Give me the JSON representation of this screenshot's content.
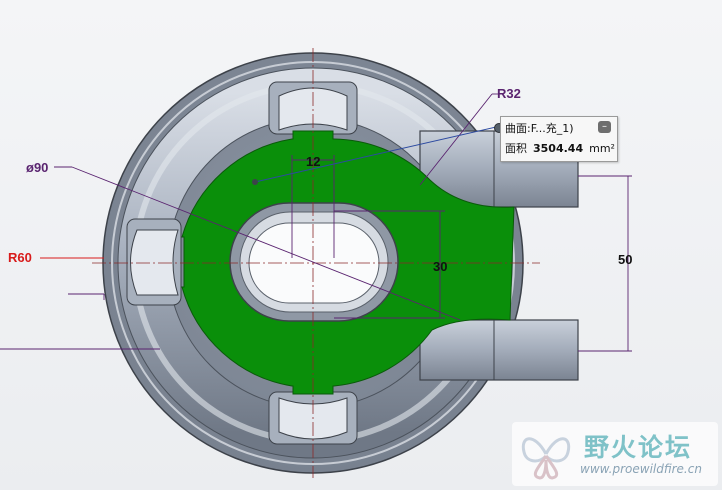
{
  "dimensions": {
    "diameter": "ø90",
    "radius_r60": "R60",
    "radius_r32": "R32",
    "width_12": "12",
    "height_30": "30",
    "spacing_50": "50"
  },
  "colors": {
    "face_selected": "#0a8f0a",
    "part_metal": "#aab3c2",
    "dim_line": "#5a2470",
    "r60_text": "#d81b1b",
    "centerline": "#8a2a2a"
  },
  "callout": {
    "surface_label": "曲面:F...充_1)",
    "area_label": "面积",
    "area_value": "3504.44",
    "area_unit": "mm²",
    "collapse_icon": "minus-icon"
  },
  "watermark": {
    "title": "野火论坛",
    "url": "www.proewildfire.cn",
    "logo_icon": "butterfly-logo-icon"
  }
}
